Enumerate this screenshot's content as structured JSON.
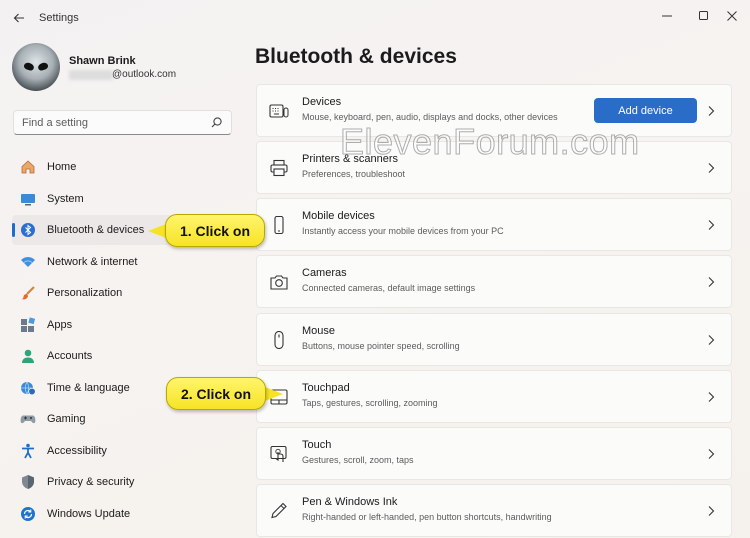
{
  "window": {
    "title": "Settings",
    "back_icon": "arrow-left-icon",
    "minimize_icon": "minimize-icon",
    "maximize_icon": "maximize-icon",
    "close_icon": "close-icon"
  },
  "profile": {
    "name": "Shawn Brink",
    "email_suffix": "@outlook.com"
  },
  "search": {
    "placeholder": "Find a setting"
  },
  "sidebar": {
    "items": [
      {
        "label": "Home",
        "icon": "home-icon"
      },
      {
        "label": "System",
        "icon": "monitor-icon"
      },
      {
        "label": "Bluetooth & devices",
        "icon": "bluetooth-icon",
        "active": true
      },
      {
        "label": "Network & internet",
        "icon": "wifi-icon"
      },
      {
        "label": "Personalization",
        "icon": "brush-icon"
      },
      {
        "label": "Apps",
        "icon": "apps-icon"
      },
      {
        "label": "Accounts",
        "icon": "person-icon"
      },
      {
        "label": "Time & language",
        "icon": "globe-clock-icon"
      },
      {
        "label": "Gaming",
        "icon": "gamepad-icon"
      },
      {
        "label": "Accessibility",
        "icon": "accessibility-icon"
      },
      {
        "label": "Privacy & security",
        "icon": "shield-icon"
      },
      {
        "label": "Windows Update",
        "icon": "update-icon"
      }
    ],
    "accent_color": "#1a6ed1"
  },
  "main": {
    "page_title": "Bluetooth & devices",
    "add_device_label": "Add device",
    "cards": [
      {
        "title": "Devices",
        "subtitle": "Mouse, keyboard, pen, audio, displays and docks, other devices",
        "icon": "devices-icon"
      },
      {
        "title": "Printers & scanners",
        "subtitle": "Preferences, troubleshoot",
        "icon": "printer-icon"
      },
      {
        "title": "Mobile devices",
        "subtitle": "Instantly access your mobile devices from your PC",
        "icon": "phone-icon"
      },
      {
        "title": "Cameras",
        "subtitle": "Connected cameras, default image settings",
        "icon": "camera-icon"
      },
      {
        "title": "Mouse",
        "subtitle": "Buttons, mouse pointer speed, scrolling",
        "icon": "mouse-icon"
      },
      {
        "title": "Touchpad",
        "subtitle": "Taps, gestures, scrolling, zooming",
        "icon": "touchpad-icon"
      },
      {
        "title": "Touch",
        "subtitle": "Gestures, scroll, zoom, taps",
        "icon": "touch-icon"
      },
      {
        "title": "Pen & Windows Ink",
        "subtitle": "Right-handed or left-handed, pen button shortcuts, handwriting",
        "icon": "pen-icon"
      }
    ],
    "button_color": "#2a6dc9"
  },
  "watermark": "ElevenForum.com",
  "callouts": [
    {
      "label": "1. Click on"
    },
    {
      "label": "2. Click on"
    }
  ]
}
